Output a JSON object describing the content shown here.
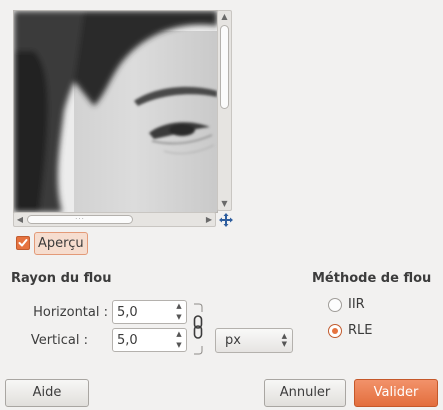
{
  "preview": {
    "checkbox_label": "Aperçu",
    "checked": true
  },
  "blur_radius": {
    "title": "Rayon du flou",
    "horizontal_label": "Horizontal :",
    "horizontal_value": "5,0",
    "vertical_label": "Vertical :",
    "vertical_value": "5,0",
    "unit": "px",
    "chain_linked": true
  },
  "blur_method": {
    "title": "Méthode de flou",
    "options": [
      {
        "label": "IIR",
        "selected": false
      },
      {
        "label": "RLE",
        "selected": true
      }
    ]
  },
  "buttons": {
    "help": "Aide",
    "cancel": "Annuler",
    "ok": "Valider"
  },
  "colors": {
    "accent": "#e36e3d",
    "background": "#f2f1f0"
  }
}
